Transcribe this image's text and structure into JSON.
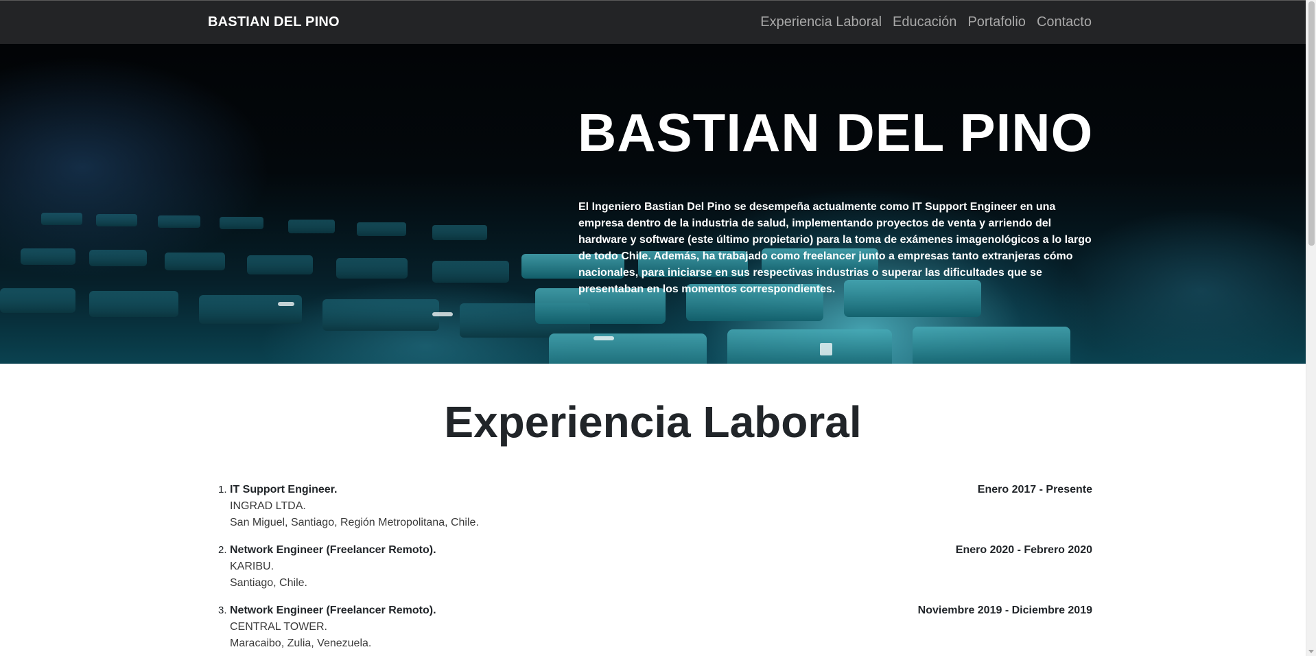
{
  "navbar": {
    "brand": "BASTIAN DEL PINO",
    "links": [
      "Experiencia Laboral",
      "Educación",
      "Portafolio",
      "Contacto"
    ]
  },
  "hero": {
    "title": "BASTIAN DEL PINO",
    "description": "El Ingeniero Bastian Del Pino se desempeña actualmente como IT Support Engineer en una empresa dentro de la industria de salud, implementando proyectos de venta y arriendo del hardware y software (este último propietario) para la toma de exámenes imagenológicos a lo largo de todo Chile. Además, ha trabajado como freelancer junto a empresas tanto extranjeras cómo nacionales, para iniciarse en sus respectivas industrias o superar las dificultades que se presentaban en los momentos correspondientes."
  },
  "experience": {
    "title": "Experiencia Laboral",
    "jobs": [
      {
        "number": "1.",
        "title": "IT Support Engineer.",
        "company": "INGRAD LTDA.",
        "location": "San Miguel, Santiago, Región Metropolitana, Chile.",
        "dates": "Enero 2017 - Presente"
      },
      {
        "number": "2.",
        "title": "Network Engineer (Freelancer Remoto).",
        "company": "KARIBU.",
        "location": "Santiago, Chile.",
        "dates": "Enero 2020 - Febrero 2020"
      },
      {
        "number": "3.",
        "title": "Network Engineer (Freelancer Remoto).",
        "company": "CENTRAL TOWER.",
        "location": "Maracaibo, Zulia, Venezuela.",
        "dates": "Noviembre 2019 - Diciembre 2019"
      }
    ]
  },
  "colors": {
    "navbar_bg": "#232426",
    "nav_link": "#a8a8a8",
    "heading": "#212529"
  }
}
